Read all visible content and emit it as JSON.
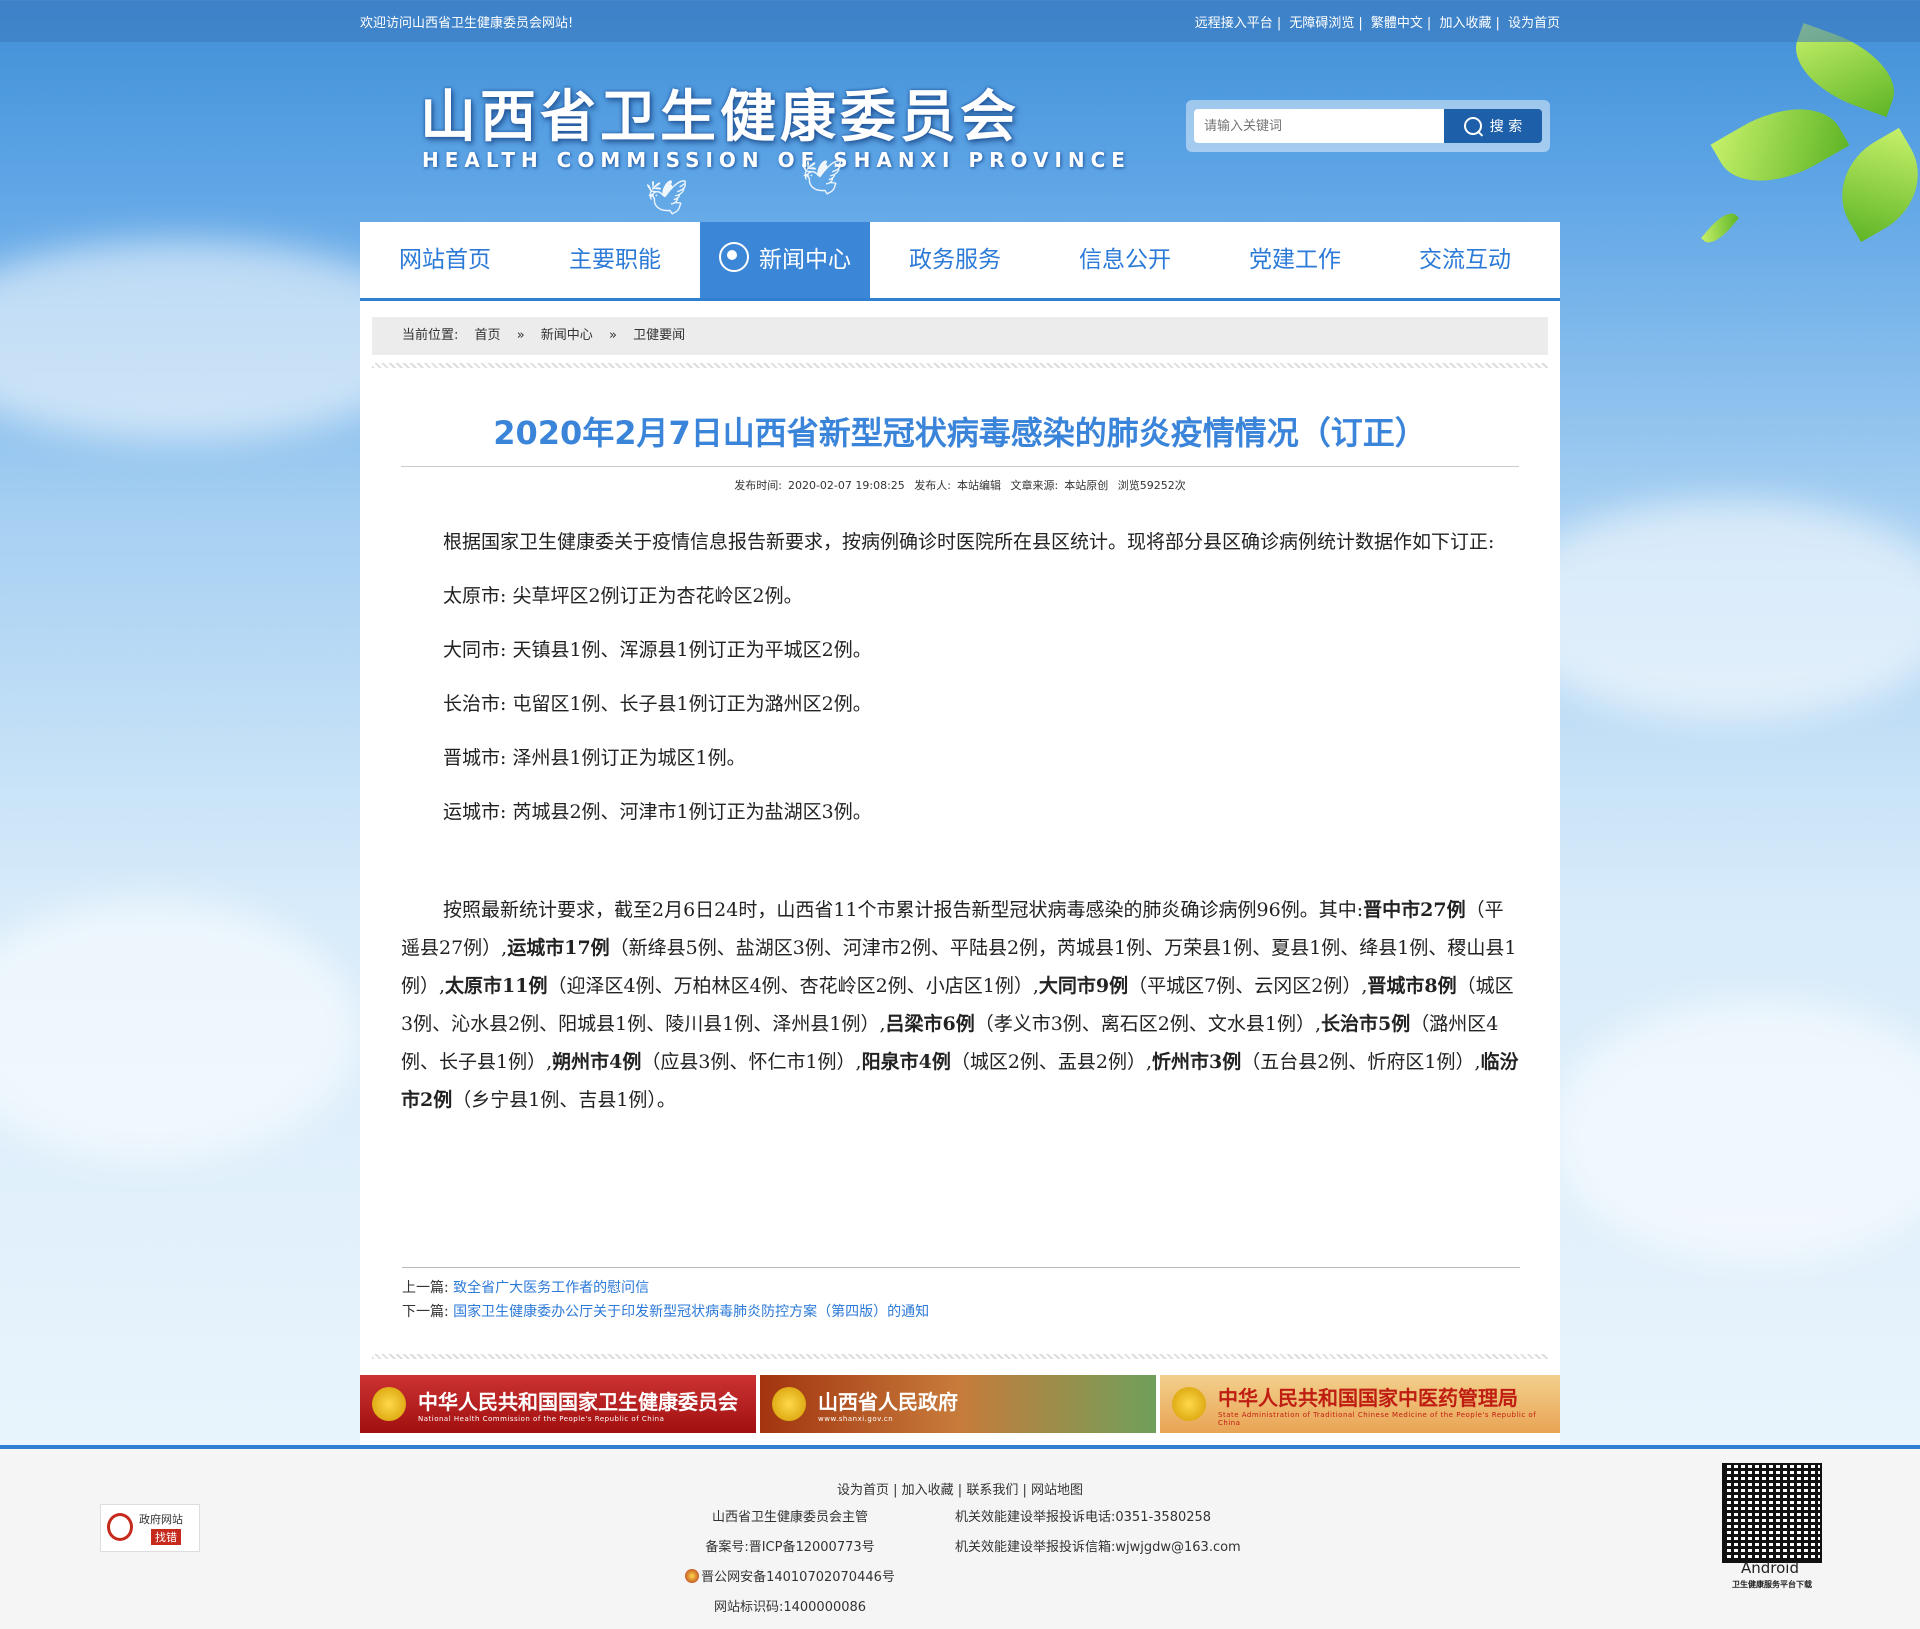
{
  "topbar": {
    "welcome": "欢迎访问山西省卫生健康委员会网站!",
    "links": [
      "远程接入平台",
      "无障碍浏览",
      "繁體中文",
      "加入收藏",
      "设为首页"
    ]
  },
  "logo": {
    "cn": "山西省卫生健康委员会",
    "en": "HEALTH COMMISSION OF SHANXI PROVINCE"
  },
  "search": {
    "placeholder": "请输入关键词",
    "button": "搜 索"
  },
  "nav": {
    "items": [
      {
        "label": "网站首页"
      },
      {
        "label": "主要职能"
      },
      {
        "label": "新闻中心",
        "active": true
      },
      {
        "label": "政务服务"
      },
      {
        "label": "信息公开"
      },
      {
        "label": "党建工作"
      },
      {
        "label": "交流互动"
      }
    ]
  },
  "breadcrumb": {
    "prefix": "当前位置:",
    "items": [
      "首页",
      "新闻中心",
      "卫健要闻"
    ],
    "separator": "»"
  },
  "article": {
    "title": "2020年2月7日山西省新型冠状病毒感染的肺炎疫情情况（订正）",
    "meta": {
      "time_label": "发布时间:",
      "time": "2020-02-07 19:08:25",
      "publisher_label": "发布人:",
      "publisher": "本站编辑",
      "source_label": "文章来源:",
      "source": "本站原创",
      "views": "浏览59252次"
    },
    "intro": "根据国家卫生健康委关于疫情信息报告新要求，按病例确诊时医院所在县区统计。现将部分县区确诊病例统计数据作如下订正:",
    "corrections": [
      "太原市: 尖草坪区2例订正为杏花岭区2例。",
      "大同市: 天镇县1例、浑源县1例订正为平城区2例。",
      "长治市: 屯留区1例、长子县1例订正为潞州区2例。",
      "晋城市: 泽州县1例订正为城区1例。",
      "运城市: 芮城县2例、河津市1例订正为盐湖区3例。"
    ],
    "summary": {
      "lead": "按照最新统计要求，截至2月6日24时，山西省11个市累计报告新型冠状病毒感染的肺炎确诊病例96例。其中:",
      "cities": [
        {
          "name": "晋中市27例",
          "detail": "（平遥县27例）,"
        },
        {
          "name": "运城市17例",
          "detail": "（新绛县5例、盐湖区3例、河津市2例、平陆县2例，芮城县1例、万荣县1例、夏县1例、绛县1例、稷山县1例）,"
        },
        {
          "name": "太原市11例",
          "detail": "（迎泽区4例、万柏林区4例、杏花岭区2例、小店区1例）,"
        },
        {
          "name": "大同市9例",
          "detail": "（平城区7例、云冈区2例）,"
        },
        {
          "name": "晋城市8例",
          "detail": "（城区3例、沁水县2例、阳城县1例、陵川县1例、泽州县1例）,"
        },
        {
          "name": "吕梁市6例",
          "detail": "（孝义市3例、离石区2例、文水县1例）,"
        },
        {
          "name": "长治市5例",
          "detail": "（潞州区4例、长子县1例）,"
        },
        {
          "name": "朔州市4例",
          "detail": "（应县3例、怀仁市1例）,"
        },
        {
          "name": "阳泉市4例",
          "detail": "（城区2例、盂县2例）,"
        },
        {
          "name": "忻州市3例",
          "detail": "（五台县2例、忻府区1例）,"
        },
        {
          "name": "临汾市2例",
          "detail": "（乡宁县1例、吉县1例）。"
        }
      ]
    },
    "prev_label": "上一篇:",
    "prev_link": "致全省广大医务工作者的慰问信",
    "next_label": "下一篇:",
    "next_link": "国家卫生健康委办公厅关于印发新型冠状病毒肺炎防控方案（第四版）的通知"
  },
  "banners": [
    {
      "main": "中华人民共和国国家卫生健康委员会",
      "sub": "National Health Commission of the People's Republic of China"
    },
    {
      "main": "山西省人民政府",
      "sub": "www.shanxi.gov.cn"
    },
    {
      "main": "中华人民共和国国家中医药管理局",
      "sub": "State Administration of Traditional Chinese Medicine of the People's Republic of China"
    }
  ],
  "footer": {
    "links": [
      "设为首页",
      "加入收藏",
      "联系我们",
      "网站地图"
    ],
    "sponsor": "山西省卫生健康委员会主管",
    "icp": "备案号:晋ICP备12000773号",
    "police": "晋公网安备14010702070446号",
    "site_id": "网站标识码:1400000086",
    "hotline": "机关效能建设举报投诉电话:0351-3580258",
    "email": "机关效能建设举报投诉信箱:wjwjgdw@163.com",
    "gov_badge_top": "政府网站",
    "gov_badge_bottom": "找错",
    "qr_caption": "Android",
    "qr_sub": "卫生健康服务平台下载"
  },
  "colors": {
    "nav_text": "#2b7ad8",
    "nav_active_bg": "#3b86d7",
    "title": "#3a84d9",
    "search_button": "#1d5fa8"
  }
}
